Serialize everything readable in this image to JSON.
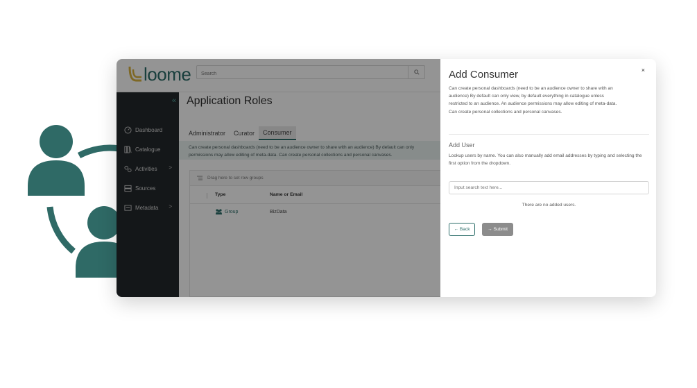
{
  "app": {
    "logo_text": "loome",
    "search_placeholder": "Search"
  },
  "sidebar": {
    "collapse_glyph": "«",
    "items": [
      {
        "label": "Dashboard",
        "icon": "dashboard-icon",
        "has_children": false
      },
      {
        "label": "Catalogue",
        "icon": "catalogue-icon",
        "has_children": false
      },
      {
        "label": "Activities",
        "icon": "activities-icon",
        "has_children": true
      },
      {
        "label": "Sources",
        "icon": "sources-icon",
        "has_children": false
      },
      {
        "label": "Metadata",
        "icon": "metadata-icon",
        "has_children": true
      }
    ]
  },
  "main": {
    "title": "Application Roles",
    "tabs": [
      {
        "label": "Administrator",
        "active": false
      },
      {
        "label": "Curator",
        "active": false
      },
      {
        "label": "Consumer",
        "active": true
      }
    ],
    "tab_desc_line1": "Can create personal dashboards (need to be an audience owner to share with an audience) By default can only",
    "tab_desc_line2": "permissions may allow editing of meta-data. Can create personal collections and personal canvases.",
    "grid": {
      "group_hint": "Drag here to set row groups",
      "columns": [
        "Type",
        "Name or Email"
      ],
      "rows": [
        {
          "type": "Group",
          "name": "BizData"
        }
      ]
    }
  },
  "panel": {
    "title": "Add Consumer",
    "close_glyph": "×",
    "description": "Can create personal dashboards (need to be an audience owner to share with an audience) By default can only view, by default everything in catalogue unless restricted to an audience. An audience permissions may allow editing of meta-data. Can create personal collections and personal canvases.",
    "add_user_title": "Add User",
    "add_user_desc": "Lookup users by name. You can also manually add email addresses by typing and selecting the first option from the dropdown.",
    "input_placeholder": "Input search text here...",
    "empty_text": "There are no added users.",
    "back_label": "← Back",
    "submit_label": "→ Submit"
  },
  "colors": {
    "brand_teal": "#2b6d69",
    "illustration_teal": "#2f6a66",
    "sidebar_bg": "#23282c",
    "logo_accent": "#d9b340"
  }
}
